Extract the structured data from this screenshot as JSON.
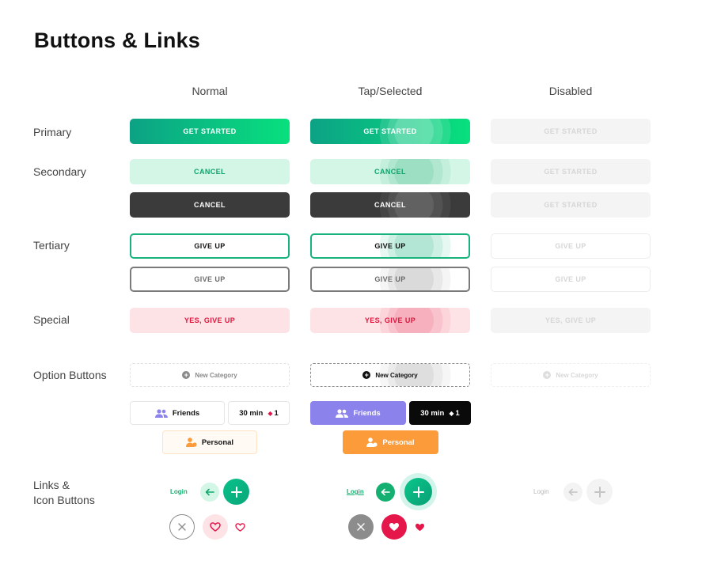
{
  "title": "Buttons & Links",
  "columns": {
    "normal": "Normal",
    "tap": "Tap/Selected",
    "disabled": "Disabled"
  },
  "rows": {
    "primary": "Primary",
    "secondary": "Secondary",
    "tertiary": "Tertiary",
    "special": "Special",
    "option": "Option Buttons",
    "links": "Links &",
    "links2": "Icon Buttons"
  },
  "buttons": {
    "get_started": "GET STARTED",
    "cancel": "CANCEL",
    "give_up": "GIVE UP",
    "yes_give_up": "YES, GIVE UP"
  },
  "options": {
    "new_category": "New Category",
    "friends": "Friends",
    "time": "30 min",
    "gem_count": "1",
    "personal": "Personal"
  },
  "links": {
    "login": "Login"
  },
  "colors": {
    "primary_start": "#0ca285",
    "primary_end": "#08e07e",
    "purple": "#8b82ec",
    "orange": "#fb9b3a",
    "pink": "#e5174a"
  }
}
